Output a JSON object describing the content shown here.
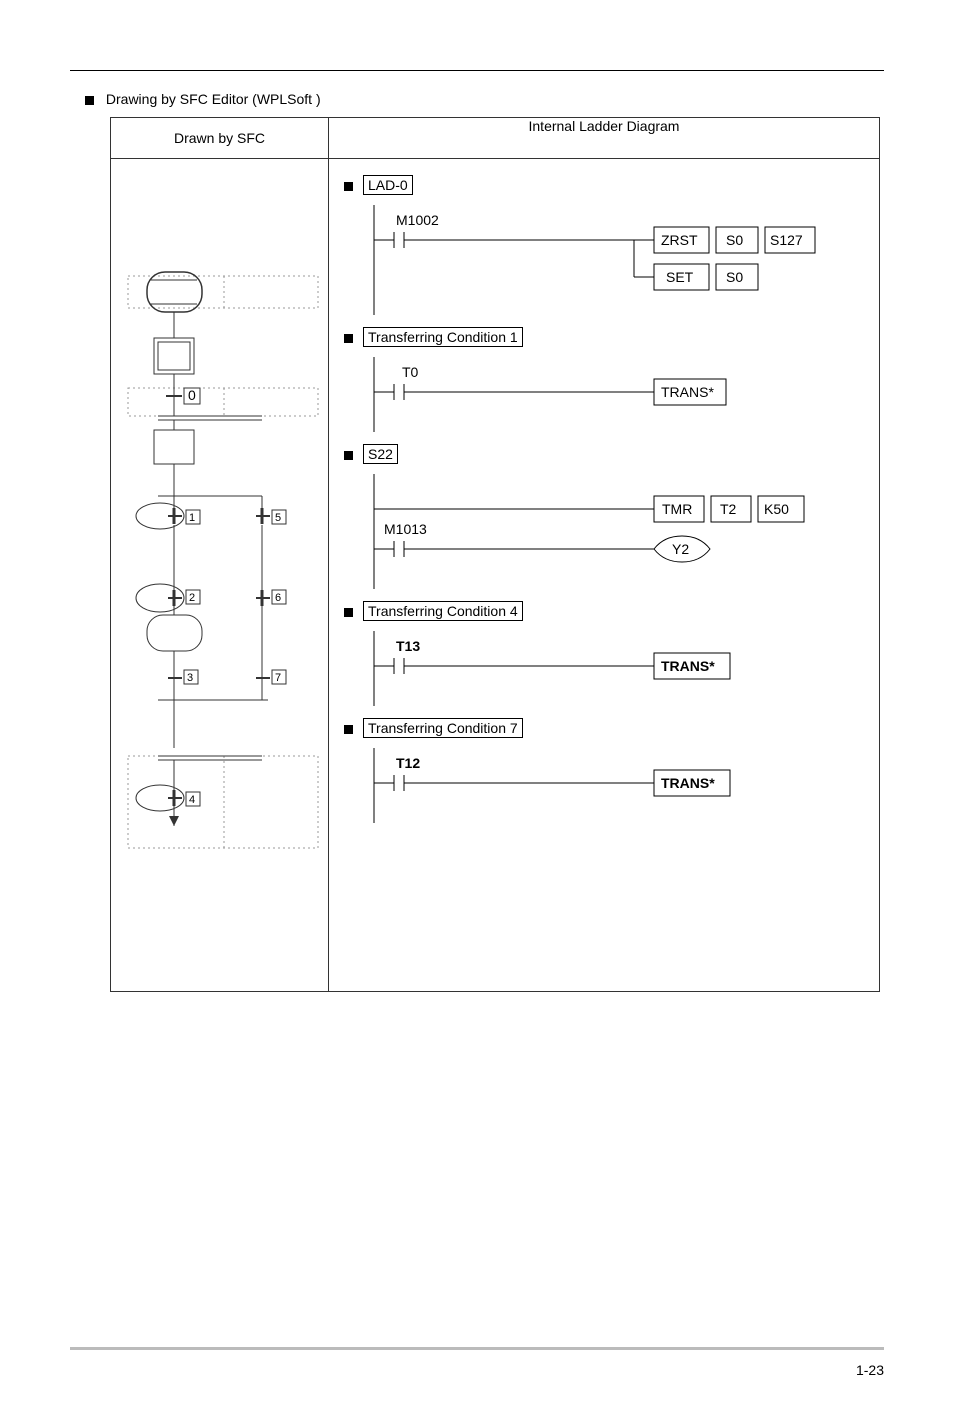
{
  "heading": "Drawing by SFC Editor (WPLSoft )",
  "table": {
    "col1_header": "Drawn by SFC",
    "col2_header": "Internal Ladder Diagram"
  },
  "sfc": {
    "trans_labels": {
      "t0": "0",
      "t1": "1",
      "t2": "2",
      "t3": "3",
      "t4": "4",
      "t5": "5",
      "t6": "6",
      "t7": "7"
    }
  },
  "ladder": {
    "sec1": {
      "title": "LAD-0",
      "contact": "M1002",
      "out1": {
        "a": "ZRST",
        "b": "S0",
        "c": "S127"
      },
      "out2": {
        "a": "SET",
        "b": "S0"
      }
    },
    "sec2": {
      "title": "Transferring Condition 1",
      "contact": "T0",
      "out": "TRANS*"
    },
    "sec3": {
      "title": "S22",
      "contact": "M1013",
      "out1": {
        "a": "TMR",
        "b": "T2",
        "c": "K50"
      },
      "coil": "Y2"
    },
    "sec4": {
      "title": "Transferring Condition 4",
      "contact": "T13",
      "out": "TRANS*"
    },
    "sec5": {
      "title": "Transferring Condition 7",
      "contact": "T12",
      "out": "TRANS*"
    }
  },
  "page_num": "1-23"
}
